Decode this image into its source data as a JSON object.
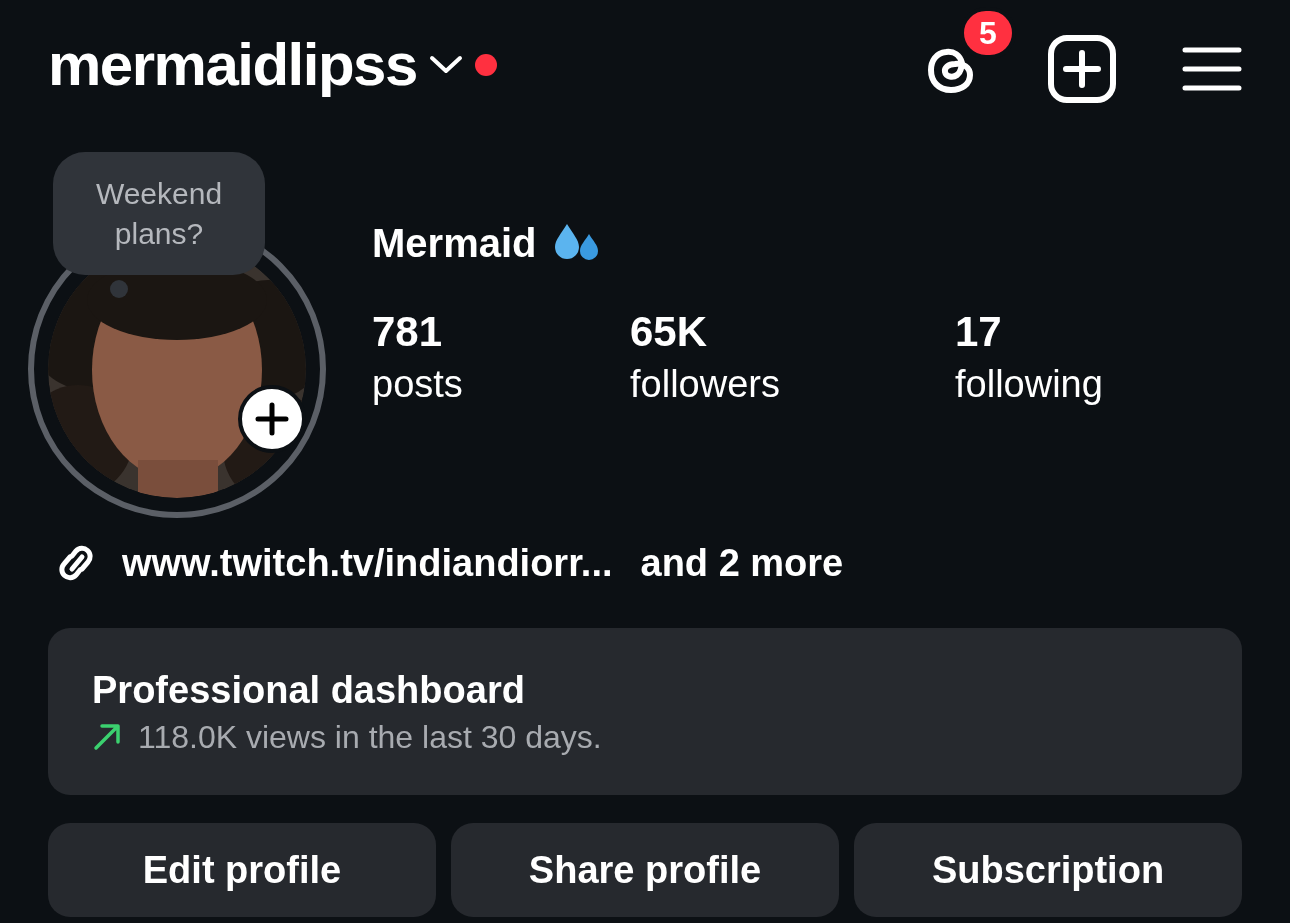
{
  "header": {
    "username": "mermaidlipss",
    "unread_dot": true,
    "threads_badge": "5"
  },
  "profile": {
    "story_note": "Weekend plans?",
    "display_name": "Mermaid",
    "stats": [
      {
        "value": "781",
        "label": "posts"
      },
      {
        "value": "65K",
        "label": "followers"
      },
      {
        "value": "17",
        "label": "following"
      }
    ]
  },
  "links": {
    "first": "www.twitch.tv/indiandiorr...",
    "more": "and 2 more"
  },
  "dashboard": {
    "title": "Professional dashboard",
    "summary": "118.0K views in the last 30 days.",
    "trending_up": true
  },
  "buttons": [
    "Edit profile",
    "Share profile",
    "Subscription"
  ]
}
